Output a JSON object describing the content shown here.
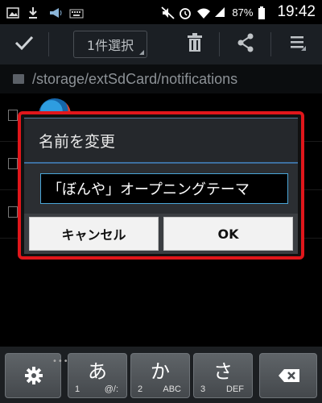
{
  "status_bar": {
    "battery_percent": "87%",
    "time": "19:42"
  },
  "action_bar": {
    "select_label": "1件選択"
  },
  "path_bar": {
    "path": "/storage/extSdCard/notifications"
  },
  "dialog": {
    "title": "名前を変更",
    "input_value": "「ぼんや」オープニングテーマ",
    "cancel_label": "キャンセル",
    "ok_label": "OK"
  },
  "keyboard": {
    "dots": "•••",
    "keys": [
      {
        "main": "あ",
        "num": "1",
        "sub": "@/:"
      },
      {
        "main": "か",
        "num": "2",
        "sub": "ABC"
      },
      {
        "main": "さ",
        "num": "3",
        "sub": "DEF"
      }
    ]
  },
  "colors": {
    "highlight_frame": "#e0161b",
    "input_border": "#4aa6d8",
    "action_bar_bg": "#1b1f24"
  }
}
